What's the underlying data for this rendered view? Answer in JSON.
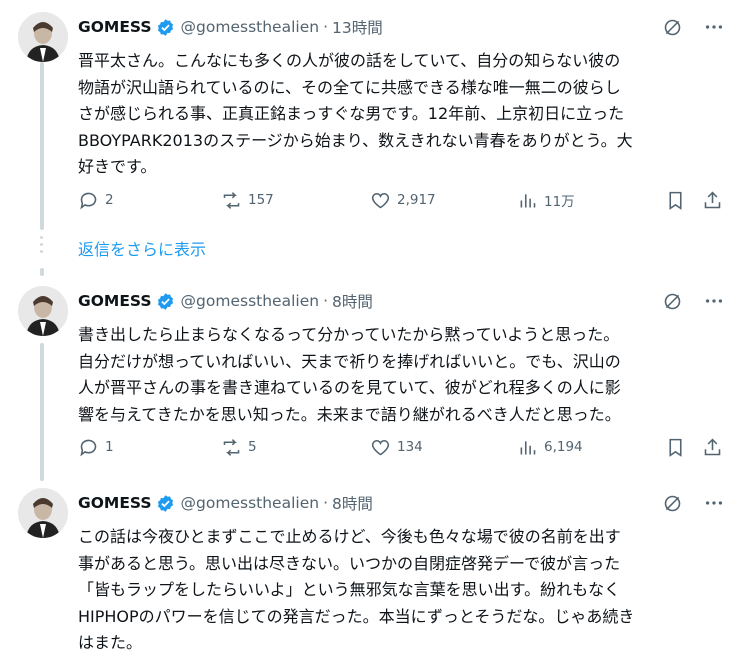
{
  "colors": {
    "link": "#1d9bf0",
    "secondary": "#536471",
    "verified": "#1d9bf0",
    "thread": "#cfd9de"
  },
  "show_more": "返信をさらに表示",
  "tweets": [
    {
      "name": "GOMESS",
      "handle": "@gomessthealien",
      "dot": "·",
      "time": "13時間",
      "text": "晋平太さん。こんなにも多くの人が彼の話をしていて、自分の知らない彼の\n物語が沢山語られているのに、その全てに共感できる様な唯一無二の彼らし\nさが感じられる事、正真正銘まっすぐな男です。12年前、上京初日に立った\nBBOYPARK2013のステージから始まり、数えきれない青春をありがとう。大\n好きです。",
      "replies": "2",
      "retweets": "157",
      "likes": "2,917",
      "views": "11万"
    },
    {
      "name": "GOMESS",
      "handle": "@gomessthealien",
      "dot": "·",
      "time": "8時間",
      "text": "書き出したら止まらなくなるって分かっていたから黙っていようと思った。\n自分だけが想っていればいい、天まで祈りを捧げればいいと。でも、沢山の\n人が晋平さんの事を書き連ねているのを見ていて、彼がどれ程多くの人に影\n響を与えてきたかを思い知った。未来まで語り継がれるべき人だと思った。",
      "replies": "1",
      "retweets": "5",
      "likes": "134",
      "views": "6,194"
    },
    {
      "name": "GOMESS",
      "handle": "@gomessthealien",
      "dot": "·",
      "time": "8時間",
      "text": "この話は今夜ひとまずここで止めるけど、今後も色々な場で彼の名前を出す\n事があると思う。思い出は尽きない。いつかの自閉症啓発デーで彼が言った\n「皆もラップをしたらいいよ」という無邪気な言葉を思い出す。紛れもなく\nHIPHOPのパワーを信じての発言だった。本当にずっとそうだな。じゃあ続き\nはまた。"
    }
  ]
}
